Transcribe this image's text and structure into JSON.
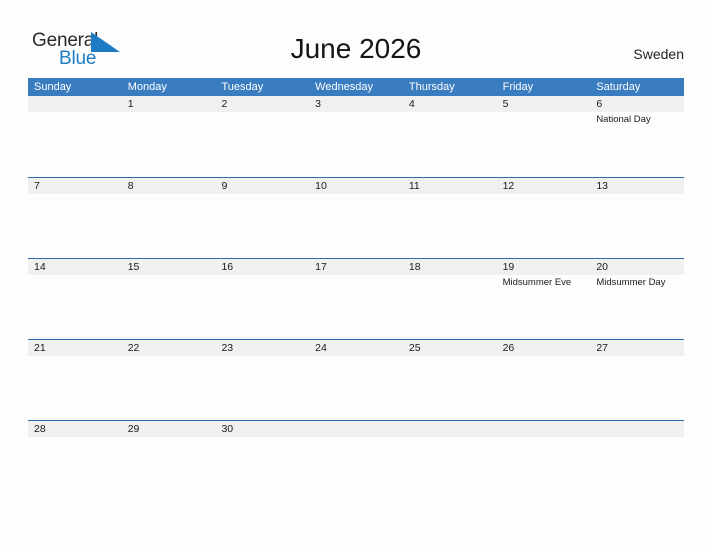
{
  "brand": {
    "name_part1": "General",
    "name_part2": "Blue",
    "flag_icon": "blue-triangle-flag-icon",
    "accent_color": "#1d7cc4"
  },
  "header": {
    "title": "June 2026",
    "country": "Sweden"
  },
  "theme": {
    "header_blue": "#3a7cc0",
    "divider_blue": "#2f6da8",
    "band_gray": "#f0f0f0",
    "page_background": "#fdfdfd",
    "text_color": "#1a1a1a"
  },
  "calendar": {
    "month": "June",
    "year": "2026",
    "weekday_headers": [
      "Sunday",
      "Monday",
      "Tuesday",
      "Wednesday",
      "Thursday",
      "Friday",
      "Saturday"
    ],
    "weeks": [
      [
        {
          "day": "",
          "events": []
        },
        {
          "day": "1",
          "events": []
        },
        {
          "day": "2",
          "events": []
        },
        {
          "day": "3",
          "events": []
        },
        {
          "day": "4",
          "events": []
        },
        {
          "day": "5",
          "events": []
        },
        {
          "day": "6",
          "events": [
            "National Day"
          ]
        }
      ],
      [
        {
          "day": "7",
          "events": []
        },
        {
          "day": "8",
          "events": []
        },
        {
          "day": "9",
          "events": []
        },
        {
          "day": "10",
          "events": []
        },
        {
          "day": "11",
          "events": []
        },
        {
          "day": "12",
          "events": []
        },
        {
          "day": "13",
          "events": []
        }
      ],
      [
        {
          "day": "14",
          "events": []
        },
        {
          "day": "15",
          "events": []
        },
        {
          "day": "16",
          "events": []
        },
        {
          "day": "17",
          "events": []
        },
        {
          "day": "18",
          "events": []
        },
        {
          "day": "19",
          "events": [
            "Midsummer Eve"
          ]
        },
        {
          "day": "20",
          "events": [
            "Midsummer Day"
          ]
        }
      ],
      [
        {
          "day": "21",
          "events": []
        },
        {
          "day": "22",
          "events": []
        },
        {
          "day": "23",
          "events": []
        },
        {
          "day": "24",
          "events": []
        },
        {
          "day": "25",
          "events": []
        },
        {
          "day": "26",
          "events": []
        },
        {
          "day": "27",
          "events": []
        }
      ],
      [
        {
          "day": "28",
          "events": []
        },
        {
          "day": "29",
          "events": []
        },
        {
          "day": "30",
          "events": []
        },
        {
          "day": "",
          "events": []
        },
        {
          "day": "",
          "events": []
        },
        {
          "day": "",
          "events": []
        },
        {
          "day": "",
          "events": []
        }
      ]
    ]
  }
}
